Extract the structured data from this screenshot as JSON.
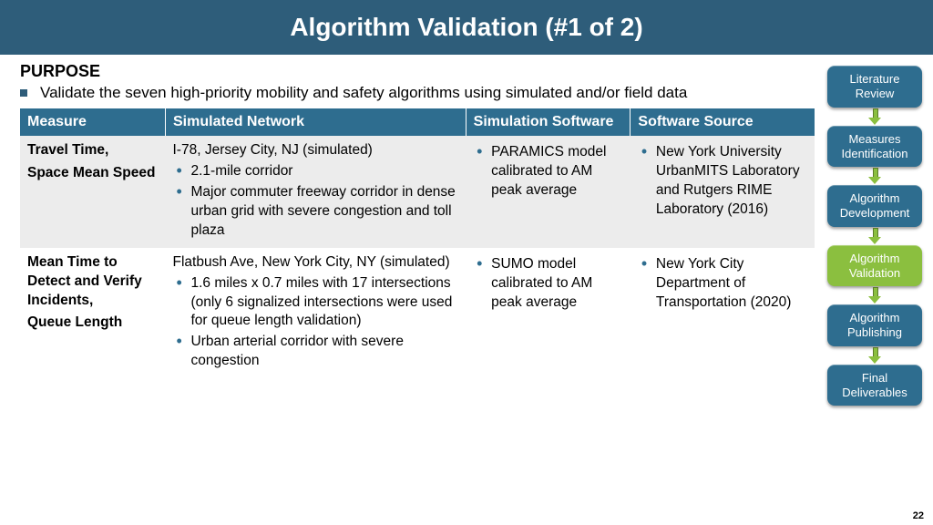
{
  "title": "Algorithm Validation (#1 of 2)",
  "purpose_heading": "PURPOSE",
  "purpose_text": "Validate the seven high-priority mobility and safety algorithms using simulated and/or field data",
  "table": {
    "headers": [
      "Measure",
      "Simulated Network",
      "Simulation Software",
      "Software Source"
    ],
    "rows": [
      {
        "measure_lines": [
          "Travel Time,",
          "Space Mean Speed"
        ],
        "network_lead": "I-78, Jersey City, NJ (simulated)",
        "network_bullets": [
          "2.1-mile corridor",
          "Major commuter freeway corridor in dense urban grid with severe congestion and toll plaza"
        ],
        "software_bullets": [
          "PARAMICS model calibrated to AM peak average"
        ],
        "source_bullets": [
          "New York University UrbanMITS Laboratory and Rutgers RIME Laboratory (2016)"
        ]
      },
      {
        "measure_lines": [
          "Mean Time to Detect and Verify Incidents,",
          "Queue Length"
        ],
        "network_lead": "Flatbush Ave, New York City, NY (simulated)",
        "network_bullets": [
          "1.6 miles x 0.7 miles with 17 intersections (only 6 signalized intersections were used for queue length validation)",
          "Urban arterial corridor with severe congestion"
        ],
        "software_bullets": [
          "SUMO model calibrated to AM peak average"
        ],
        "source_bullets": [
          "New York City Department of Transportation (2020)"
        ]
      }
    ]
  },
  "flow": [
    {
      "label": "Literature Review",
      "active": false
    },
    {
      "label": "Measures Identification",
      "active": false
    },
    {
      "label": "Algorithm Development",
      "active": false
    },
    {
      "label": "Algorithm Validation",
      "active": true
    },
    {
      "label": "Algorithm Publishing",
      "active": false
    },
    {
      "label": "Final Deliverables",
      "active": false
    }
  ],
  "page_number": "22"
}
